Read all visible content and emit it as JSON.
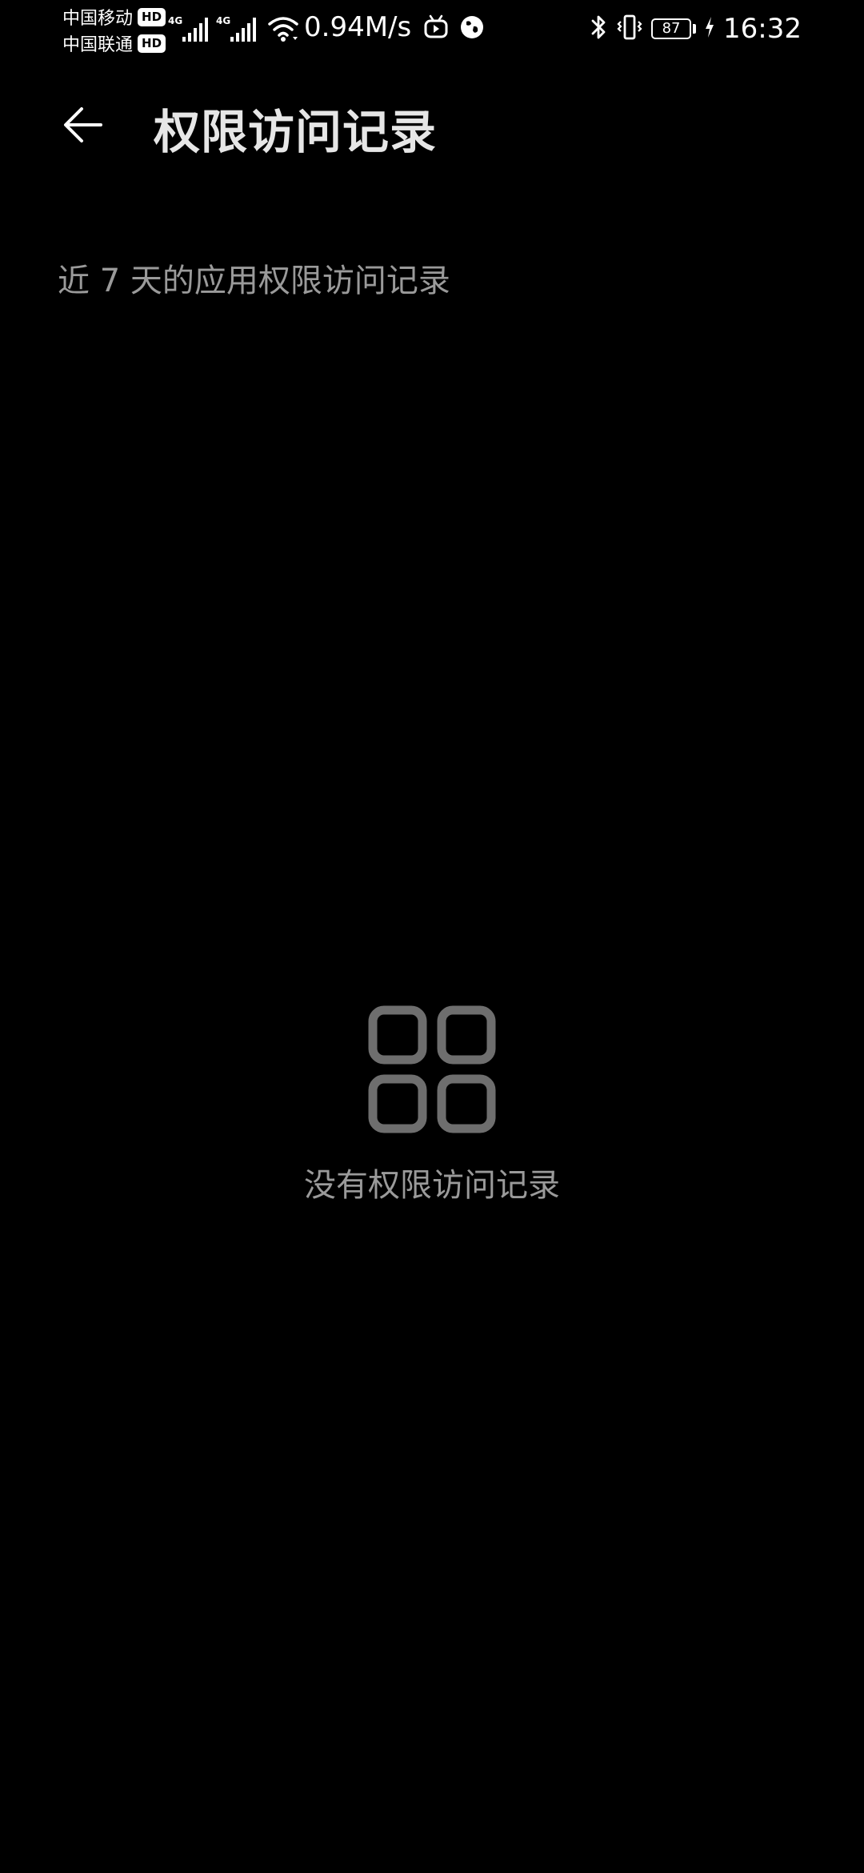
{
  "status_bar": {
    "carrier_1": "中国移动",
    "carrier_2": "中国联通",
    "hd_label": "HD",
    "network_type": "4G",
    "net_speed": "0.94M/s",
    "battery_level": "87",
    "time": "16:32"
  },
  "header": {
    "title": "权限访问记录",
    "back_icon": "back-arrow-icon"
  },
  "section": {
    "subtitle": "近 7 天的应用权限访问记录"
  },
  "empty_state": {
    "icon": "app-grid-icon",
    "message": "没有权限访问记录"
  },
  "colors": {
    "background": "#000000",
    "title_text": "#e6e6e6",
    "secondary_text": "#9a9a9a",
    "empty_icon": "#6e6e6e"
  }
}
